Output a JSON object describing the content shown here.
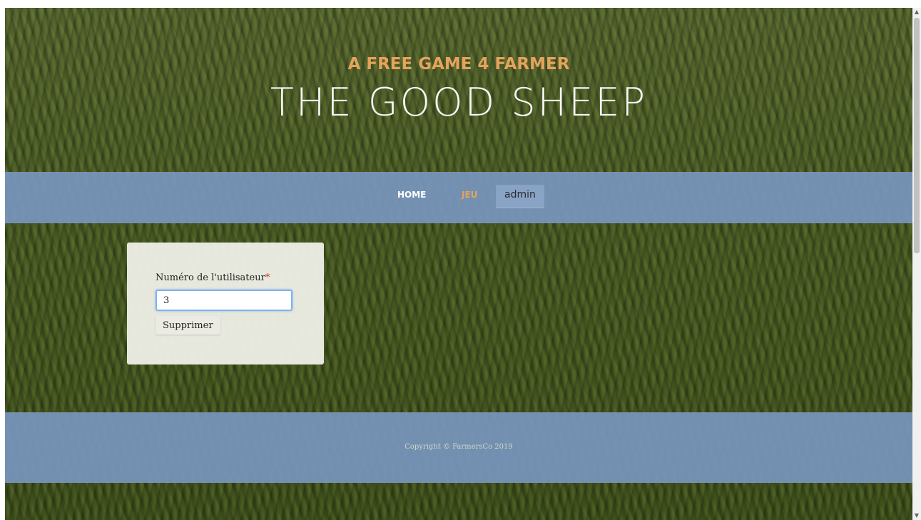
{
  "header": {
    "tagline": "A FREE GAME 4 FARMER",
    "title": "THE GOOD SHEEP"
  },
  "nav": {
    "items": [
      {
        "label": "HOME"
      },
      {
        "label": "JEU"
      },
      {
        "label": "admin"
      }
    ]
  },
  "form": {
    "label": "Numéro de l'utilisateur",
    "required_marker": "*",
    "input_value": "3",
    "submit_label": "Supprimer"
  },
  "footer": {
    "copyright": "Copyright © FarmersCo 2019"
  },
  "colors": {
    "accent": "#e5a35c",
    "nav_bg": "#7896be",
    "required": "#d0342c"
  }
}
